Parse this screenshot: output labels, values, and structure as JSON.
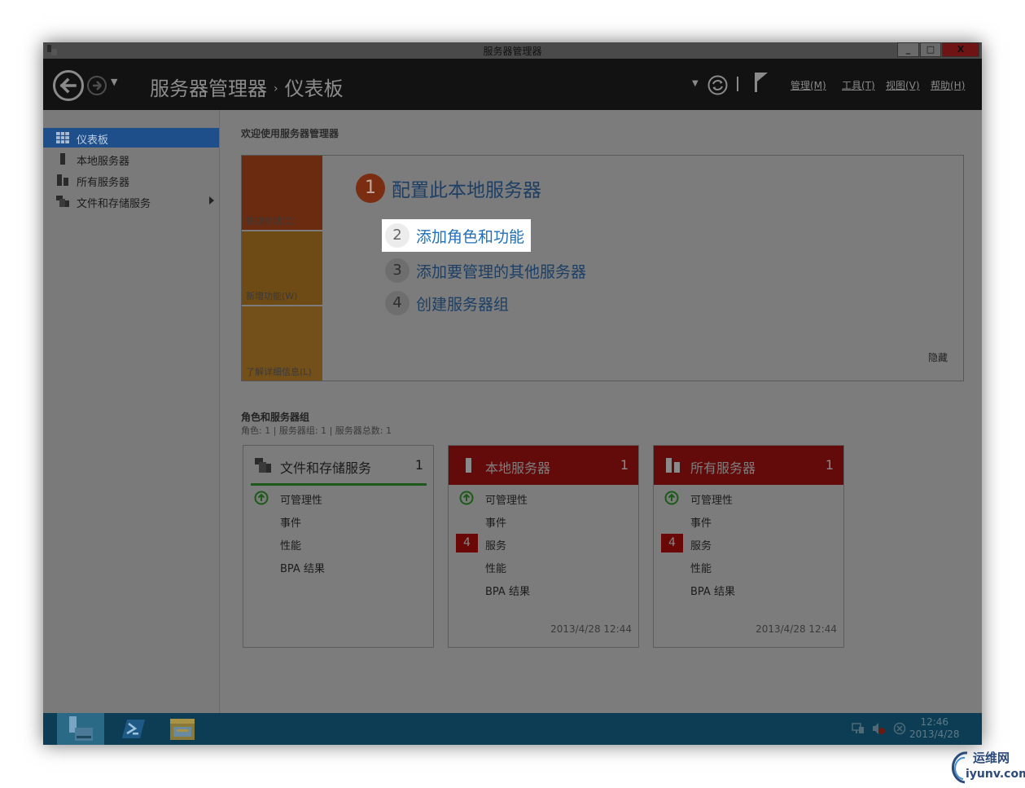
{
  "window": {
    "title": "服务器管理器",
    "controls": {
      "minimize": "_",
      "maximize": "□",
      "close": "X"
    }
  },
  "header": {
    "breadcrumb": [
      "服务器管理器",
      "仪表板"
    ],
    "breadcrumb_separator": "›",
    "menus": [
      "管理(M)",
      "工具(T)",
      "视图(V)",
      "帮助(H)"
    ]
  },
  "sidebar": {
    "items": [
      {
        "label": "仪表板",
        "icon": "dashboard-icon",
        "active": true
      },
      {
        "label": "本地服务器",
        "icon": "server-icon"
      },
      {
        "label": "所有服务器",
        "icon": "servers-icon"
      },
      {
        "label": "文件和存储服务",
        "icon": "storage-icon",
        "has_submenu": true
      }
    ]
  },
  "welcome": {
    "title": "欢迎使用服务器管理器",
    "tiles": [
      {
        "label": "快速启动(Q)",
        "color": "#6b2b10"
      },
      {
        "label": "新增功能(W)",
        "color": "#6e4a14"
      },
      {
        "label": "了解详细信息(L)",
        "color": "#73501a"
      }
    ],
    "steps": [
      {
        "num": "1",
        "text": "配置此本地服务器"
      },
      {
        "num": "2",
        "text": "添加角色和功能"
      },
      {
        "num": "3",
        "text": "添加要管理的其他服务器"
      },
      {
        "num": "4",
        "text": "创建服务器组"
      }
    ],
    "hide_label": "隐藏"
  },
  "roles": {
    "title": "角色和服务器组",
    "summary": "角色: 1 | 服务器组: 1 | 服务器总数: 1",
    "cards": [
      {
        "name": "文件和存储服务",
        "count": "1",
        "rows": [
          "可管理性",
          "事件",
          "性能",
          "BPA 结果"
        ],
        "timestamp": ""
      },
      {
        "name": "本地服务器",
        "count": "1",
        "rows": [
          "可管理性",
          "事件",
          "服务",
          "性能",
          "BPA 结果"
        ],
        "badge": "4",
        "timestamp": "2013/4/28 12:44"
      },
      {
        "name": "所有服务器",
        "count": "1",
        "rows": [
          "可管理性",
          "事件",
          "服务",
          "性能",
          "BPA 结果"
        ],
        "badge": "4",
        "timestamp": "2013/4/28 12:44"
      }
    ]
  },
  "taskbar": {
    "apps": [
      "server-manager-icon",
      "powershell-icon",
      "file-explorer-icon"
    ],
    "clock_time": "12:46",
    "clock_date": "2013/4/28"
  },
  "watermark": {
    "cn": "运维网",
    "en": "iyunv.com"
  },
  "colors": {
    "accent_red": "#630a0a",
    "accent_blue": "#1f4f8a",
    "link": "#2170b8",
    "taskbar": "#0d3d54"
  }
}
